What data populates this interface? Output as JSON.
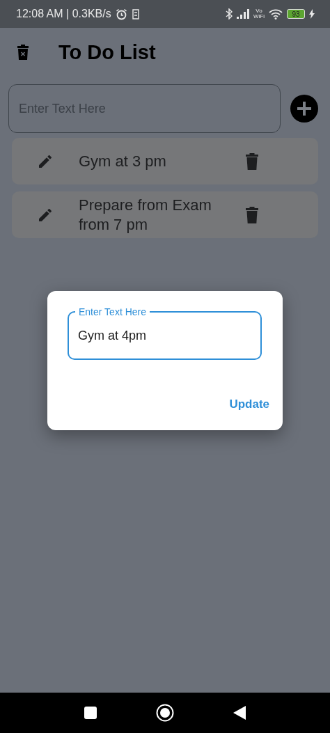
{
  "status_bar": {
    "time_speed": "12:08 AM | 0.3KB/s",
    "vo": "Vo",
    "wifi": "WiFi",
    "battery": "93"
  },
  "app_bar": {
    "title": "To Do List"
  },
  "new_task": {
    "placeholder": "Enter Text Here"
  },
  "tasks": [
    {
      "text": "Gym at 3 pm"
    },
    {
      "text": "Prepare from Exam from 7 pm"
    }
  ],
  "dialog": {
    "field_label": "Enter Text Here",
    "value": "Gym at 4pm",
    "button": "Update"
  }
}
